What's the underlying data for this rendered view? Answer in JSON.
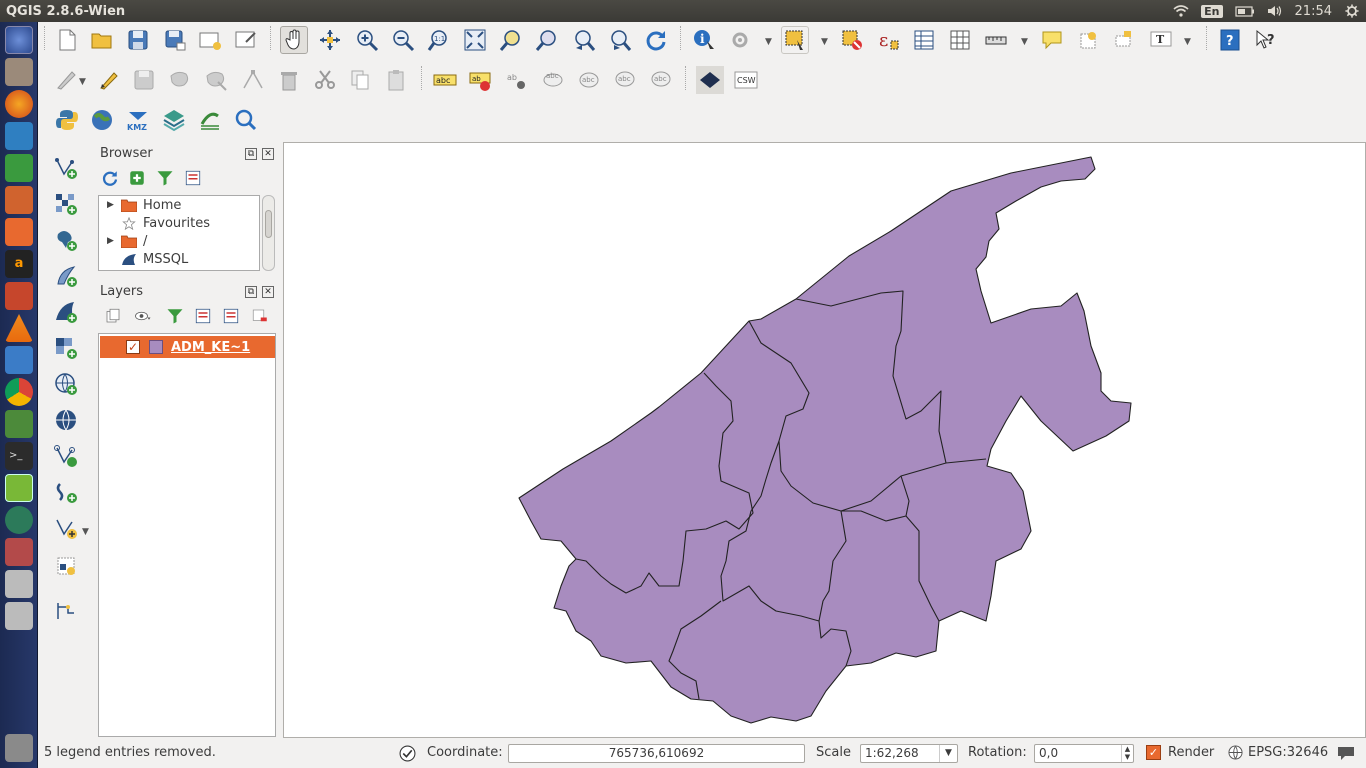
{
  "window": {
    "title": "QGIS 2.8.6-Wien"
  },
  "system_tray": {
    "keyboard_layout": "En",
    "clock": "21:54"
  },
  "browser_panel": {
    "title": "Browser",
    "items": [
      {
        "label": "Home",
        "expandable": true
      },
      {
        "label": "Favourites",
        "expandable": false
      },
      {
        "label": "/",
        "expandable": true
      },
      {
        "label": "MSSQL",
        "expandable": false
      }
    ]
  },
  "layers_panel": {
    "title": "Layers",
    "layers": [
      {
        "name": "ADM_KE~1",
        "visible": true,
        "color": "#a88cbf"
      }
    ]
  },
  "toolbar": {
    "labeling_text": "abc",
    "csw_label": "CSW",
    "kmz_label": "KMZ",
    "text_tool": "T"
  },
  "status_bar": {
    "message": "5 legend entries removed.",
    "coordinate_label": "Coordinate:",
    "coordinate_value": "765736,610692",
    "scale_label": "Scale",
    "scale_value": "1:62,268",
    "rotation_label": "Rotation:",
    "rotation_value": "0,0",
    "render_label": "Render",
    "render_checked": true,
    "crs_label": "EPSG:32646"
  },
  "colors": {
    "layer_fill": "#a88cbf",
    "selection": "#e8692f",
    "panel_bg": "#f2f1f0"
  }
}
